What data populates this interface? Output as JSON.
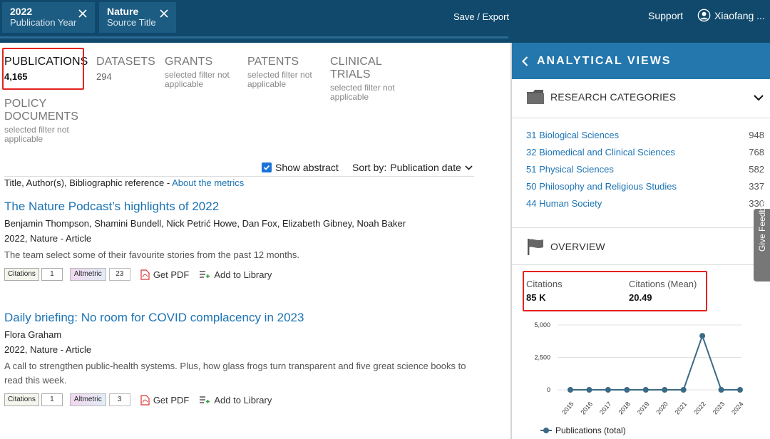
{
  "filters": [
    {
      "value": "2022",
      "label": "Publication Year"
    },
    {
      "value": "Nature",
      "label": "Source Title"
    }
  ],
  "header": {
    "save_export": "Save / Export",
    "support": "Support",
    "user": "Xiaofang ..."
  },
  "tabs": [
    {
      "title": "PUBLICATIONS",
      "count": "4,165",
      "note": ""
    },
    {
      "title": "DATASETS",
      "count": "294",
      "note": ""
    },
    {
      "title": "GRANTS",
      "count": "",
      "note": "selected filter not applicable"
    },
    {
      "title": "PATENTS",
      "count": "",
      "note": "selected filter not applicable"
    },
    {
      "title": "CLINICAL TRIALS",
      "count": "",
      "note": "selected filter not applicable"
    },
    {
      "title": "POLICY DOCUMENTS",
      "count": "",
      "note": "selected filter not applicable"
    }
  ],
  "controls": {
    "show_abstract": "Show abstract",
    "show_abstract_checked": true,
    "sort_label": "Sort by:",
    "sort_value": "Publication date"
  },
  "bibline": {
    "text": "Title, Author(s), Bibliographic reference - ",
    "link": "About the metrics"
  },
  "results": [
    {
      "title": "The Nature Podcast’s highlights of 2022",
      "authors": "Benjamin Thompson, Shamini Bundell, Nick Petrić Howe, Dan Fox, Elizabeth Gibney, Noah Baker",
      "meta": "2022, Nature - Article",
      "abstract": "The team select some of their favourite stories from the past 12 months.",
      "citations_label": "Citations",
      "citations": "1",
      "altmetric_label": "Altmetric",
      "altmetric": "23",
      "pdf": "Get PDF",
      "library": "Add to Library"
    },
    {
      "title": "Daily briefing: No room for COVID complacency in 2023",
      "authors": "Flora Graham",
      "meta": "2022, Nature - Article",
      "abstract": "A call to strengthen public-health systems. Plus, how glass frogs turn transparent and five great science books to read this week.",
      "citations_label": "Citations",
      "citations": "1",
      "altmetric_label": "Altmetric",
      "altmetric": "3",
      "pdf": "Get PDF",
      "library": "Add to Library"
    }
  ],
  "panel": {
    "title": "ANALYTICAL VIEWS",
    "research_title": "RESEARCH CATEGORIES",
    "categories": [
      {
        "name": "31 Biological Sciences",
        "count": "948"
      },
      {
        "name": "32 Biomedical and Clinical Sciences",
        "count": "768"
      },
      {
        "name": "51 Physical Sciences",
        "count": "582"
      },
      {
        "name": "50 Philosophy and Religious Studies",
        "count": "337"
      },
      {
        "name": "44 Human Society",
        "count": "330"
      }
    ],
    "overview_title": "OVERVIEW",
    "citations_label": "Citations",
    "citations_value": "85 K",
    "mean_label": "Citations (Mean)",
    "mean_value": "20.49",
    "feedback": "Give Feedback"
  },
  "chart_data": {
    "type": "line",
    "x": [
      "2015",
      "2016",
      "2017",
      "2018",
      "2019",
      "2020",
      "2021",
      "2022",
      "2023",
      "2024"
    ],
    "series": [
      {
        "name": "Publications (total)",
        "values": [
          0,
          0,
          0,
          0,
          0,
          0,
          0,
          4165,
          0,
          0
        ]
      }
    ],
    "ylim": [
      0,
      5000
    ],
    "yticks": [
      "0",
      "2,500",
      "5,000"
    ],
    "color": "#3b6a86",
    "grid": true,
    "legend": "bottom"
  }
}
